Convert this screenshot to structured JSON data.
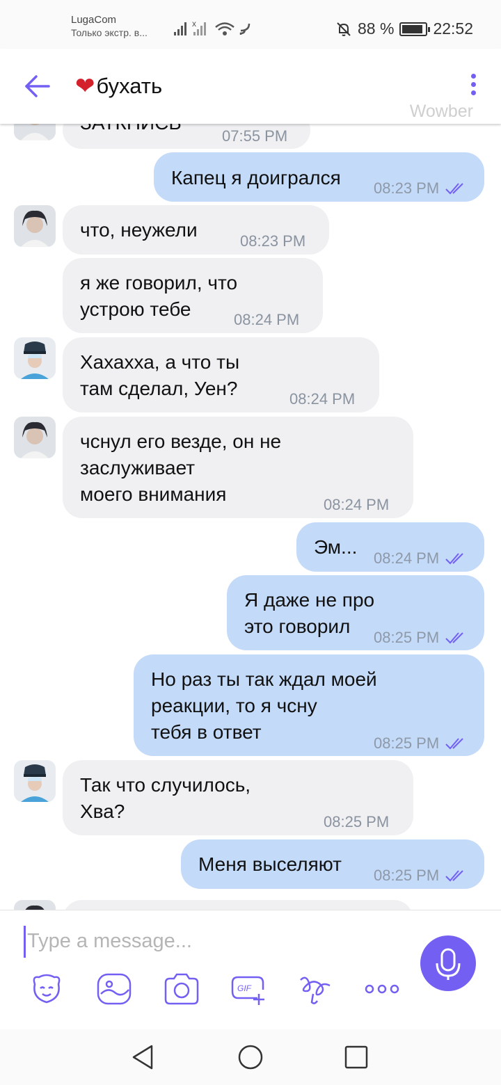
{
  "status_bar": {
    "carrier": "LugaCom",
    "network_note": "Только экстр. в...",
    "battery": "88 %",
    "battery_level": 0.88,
    "time": "22:52"
  },
  "header": {
    "title": "бухать",
    "watermark": "Wowber"
  },
  "messages": [
    {
      "dir": "in",
      "text": "ЗАТКНИСЬ",
      "time": "07:55 PM"
    },
    {
      "dir": "out",
      "text": "Капец я доигрался",
      "time": "08:23 PM"
    },
    {
      "dir": "in",
      "text": "что, неужели",
      "time": "08:23 PM"
    },
    {
      "dir": "in",
      "text": "я же говорил, что\nустрою тебе",
      "time": "08:24 PM"
    },
    {
      "dir": "in",
      "text": "Хахахха, а что ты\nтам сделал, Уен?",
      "time": "08:24 PM"
    },
    {
      "dir": "in",
      "text": "чснул его везде, он не\nзаслуживает\nмоего внимания",
      "time": "08:24 PM"
    },
    {
      "dir": "out",
      "text": "Эм...",
      "time": "08:24 PM"
    },
    {
      "dir": "out",
      "text": "Я даже не про\nэто говорил",
      "time": "08:25 PM"
    },
    {
      "dir": "out",
      "text": "Но раз ты так ждал моей\nреакции, то я чсну\nтебя в ответ",
      "time": "08:25 PM"
    },
    {
      "dir": "in",
      "text": "Так что случилось,\nХва?",
      "time": "08:25 PM"
    },
    {
      "dir": "out",
      "text": "Меня выселяют",
      "time": "08:25 PM"
    }
  ],
  "composer": {
    "placeholder": "Type a message...",
    "tools": [
      "sticker-icon",
      "gallery-icon",
      "camera-icon",
      "gif-icon",
      "doodle-icon",
      "more-icon"
    ]
  },
  "colors": {
    "accent": "#7360f2",
    "outgoing_bubble": "#c4daf9",
    "incoming_bubble": "#f0f0f2"
  }
}
